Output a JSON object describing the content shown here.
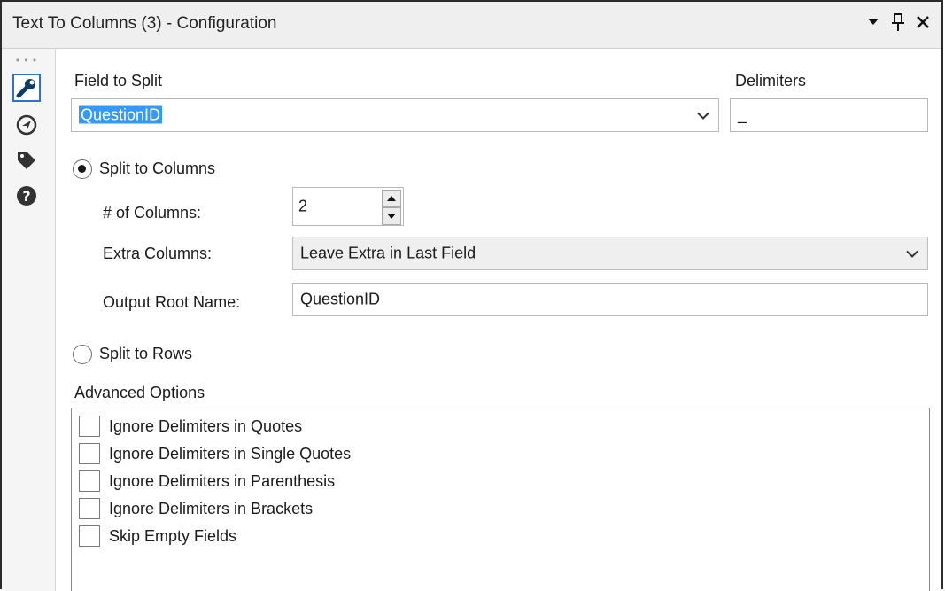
{
  "panel": {
    "title": "Text To Columns (3) - Configuration",
    "buttons": [
      "dropdown-arrow-icon",
      "pin-icon",
      "close-icon"
    ]
  },
  "sidebar": {
    "items": [
      {
        "icon": "wrench-icon",
        "active": true
      },
      {
        "icon": "navigate-icon",
        "active": false
      },
      {
        "icon": "tag-icon",
        "active": false
      },
      {
        "icon": "help-icon",
        "active": false
      }
    ]
  },
  "config": {
    "field_to_split_label": "Field to Split",
    "field_to_split_value": "QuestionID",
    "delimiters_label": "Delimiters",
    "delimiters_value": "_",
    "split_to_columns_label": "Split to Columns",
    "split_to_columns_selected": true,
    "num_columns_label": "# of Columns:",
    "num_columns_value": "2",
    "extra_columns_label": "Extra Columns:",
    "extra_columns_value": "Leave Extra in Last Field",
    "output_root_label": "Output Root Name:",
    "output_root_value": "QuestionID",
    "split_to_rows_label": "Split to Rows",
    "split_to_rows_selected": false,
    "advanced_label": "Advanced Options",
    "advanced_options": [
      {
        "label": "Ignore Delimiters in Quotes",
        "checked": false
      },
      {
        "label": "Ignore Delimiters in Single Quotes",
        "checked": false
      },
      {
        "label": "Ignore Delimiters in Parenthesis",
        "checked": false
      },
      {
        "label": "Ignore Delimiters in Brackets",
        "checked": false
      },
      {
        "label": "Skip Empty Fields",
        "checked": false
      }
    ]
  },
  "colors": {
    "selection": "#3399ff",
    "active_tool_border": "#2f6fd6",
    "titlebar_bg": "#efefef"
  }
}
